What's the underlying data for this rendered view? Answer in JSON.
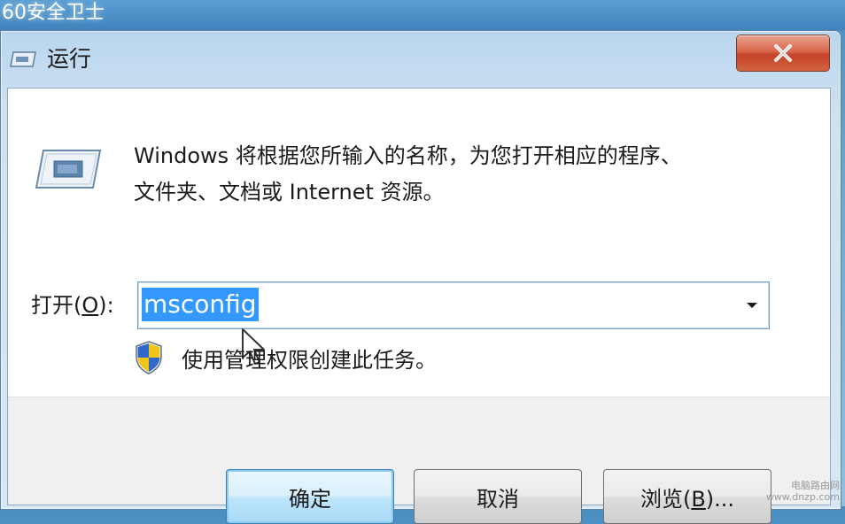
{
  "background_app": {
    "title": "60安全卫士"
  },
  "dialog": {
    "title": "运行",
    "description_line1": "Windows 将根据您所输入的名称，为您打开相应的程序、",
    "description_line2": "文件夹、文档或 Internet 资源。",
    "open_label_prefix": "打开(",
    "open_label_accel": "O",
    "open_label_suffix": "):",
    "open_value": "msconfig",
    "admin_note": "使用管理权限创建此任务。",
    "buttons": {
      "ok": "确定",
      "cancel": "取消",
      "browse_prefix": "浏览(",
      "browse_accel": "B",
      "browse_suffix": ")..."
    }
  },
  "watermark": {
    "line1": "电脑路由网",
    "line2": "www.dnzp.com"
  },
  "icons": {
    "title": "run-icon",
    "close": "close-icon",
    "main": "run-icon",
    "dropdown": "chevron-down-icon",
    "admin": "uac-shield-icon",
    "pointer": "mouse-cursor-icon"
  },
  "colors": {
    "selection": "#3399ff",
    "close_button": "#d0533a",
    "default_button_border": "#3c7fb1"
  }
}
